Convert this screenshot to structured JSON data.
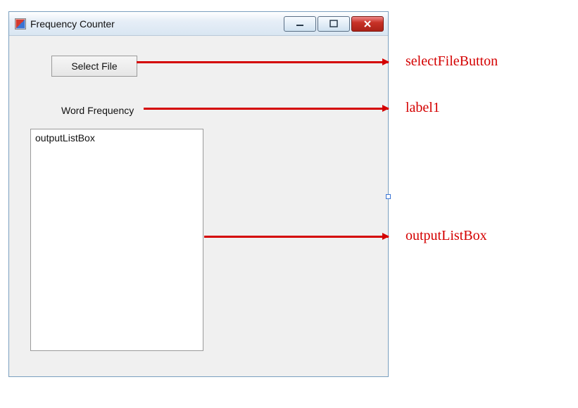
{
  "window": {
    "title": "Frequency Counter"
  },
  "controls": {
    "selectFileButton": {
      "text": "Select File"
    },
    "label1": {
      "text": "Word Frequency"
    },
    "outputListBox": {
      "firstItem": "outputListBox"
    }
  },
  "annotations": {
    "a1": "selectFileButton",
    "a2": "label1",
    "a3": "outputListBox"
  }
}
